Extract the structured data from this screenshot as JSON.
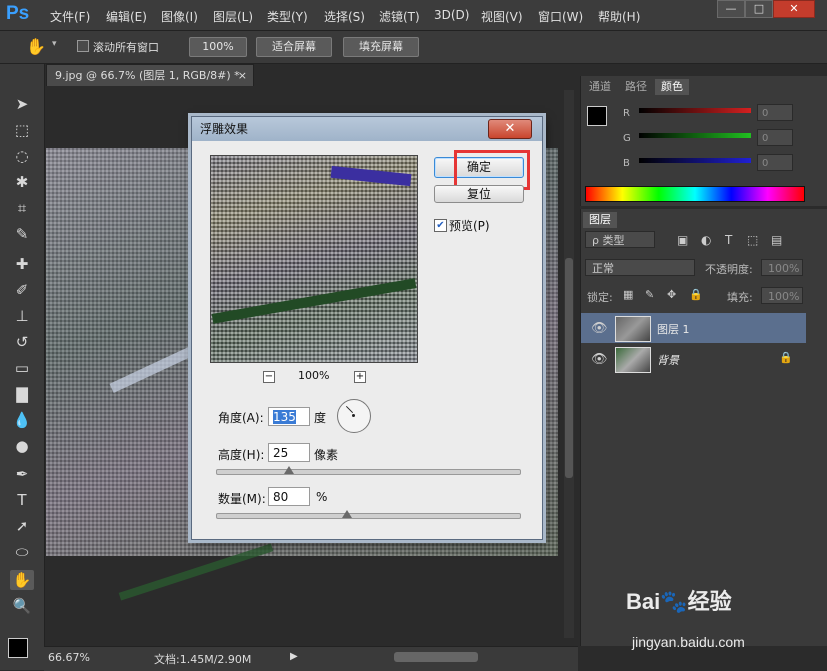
{
  "app": {
    "logo": "Ps"
  },
  "menu": [
    "文件(F)",
    "编辑(E)",
    "图像(I)",
    "图层(L)",
    "类型(Y)",
    "选择(S)",
    "滤镜(T)",
    "3D(D)",
    "视图(V)",
    "窗口(W)",
    "帮助(H)"
  ],
  "window_controls": {
    "minimize": "—",
    "restore": "□",
    "close": "✕"
  },
  "options": {
    "scroll_all_label": "滚动所有窗口",
    "zoom_100": "100%",
    "fit_screen": "适合屏幕",
    "fill_screen": "填充屏幕"
  },
  "document": {
    "tab_title": "9.jpg @ 66.7% (图层 1, RGB/8#) *",
    "tab_close": "×"
  },
  "status": {
    "zoom": "66.67%",
    "doc_info": "文档:1.45M/2.90M"
  },
  "color_panel": {
    "tabs": [
      "通道",
      "路径",
      "颜色"
    ],
    "active_tab": "颜色",
    "sliders": [
      {
        "label": "R",
        "value": "0",
        "color": "#d42020"
      },
      {
        "label": "G",
        "value": "0",
        "color": "#20c020"
      },
      {
        "label": "B",
        "value": "0",
        "color": "#2020d4"
      }
    ]
  },
  "layers_panel": {
    "tab": "图层",
    "filter_label": "ρ 类型",
    "blend_mode": "正常",
    "opacity_label": "不透明度:",
    "opacity_value": "100%",
    "lock_label": "锁定:",
    "fill_label": "填充:",
    "fill_value": "100%",
    "layers": [
      {
        "name": "图层 1",
        "selected": true
      },
      {
        "name": "背景",
        "selected": false
      }
    ]
  },
  "dialog": {
    "title": "浮雕效果",
    "close": "✕",
    "ok_label": "确定",
    "reset_label": "复位",
    "preview_label": "预览(P)",
    "preview_zoom": "100%",
    "zoom_minus": "−",
    "zoom_plus": "+",
    "angle_label": "角度(A):",
    "angle_value": "135",
    "angle_unit": "度",
    "height_label": "高度(H):",
    "height_value": "25",
    "height_unit": "像素",
    "amount_label": "数量(M):",
    "amount_value": "80",
    "amount_unit": "%"
  },
  "watermark": {
    "main": "Bai🐾经验",
    "sub": "jingyan.baidu.com"
  },
  "colors": {
    "accent_blue": "#3aa0ff",
    "highlight_red": "#e53535",
    "selected_layer": "#5b6f8e"
  }
}
